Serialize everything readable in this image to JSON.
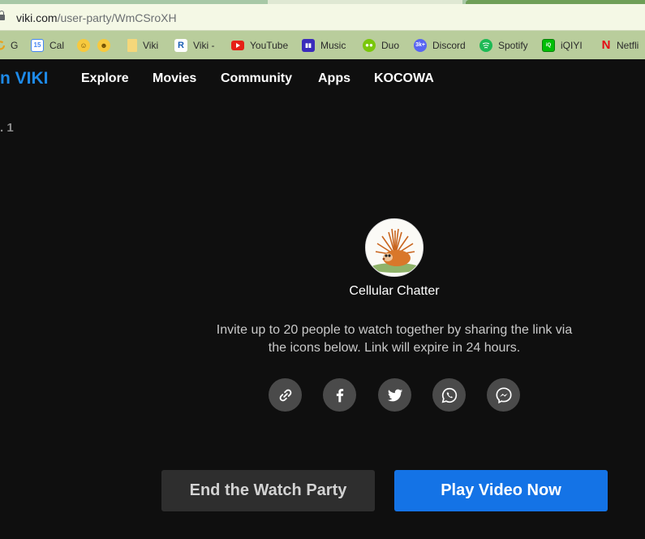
{
  "browser": {
    "url_host": "viki.com",
    "url_path": "/user-party/WmCSroXH",
    "bookmarks": [
      {
        "label": "G",
        "icon": "google-icon"
      },
      {
        "label": "Cal",
        "icon": "calendar-icon"
      },
      {
        "label": "",
        "icon": "smiley-icon"
      },
      {
        "label": "",
        "icon": "yum-emoji-icon"
      },
      {
        "label": "Viki",
        "icon": "folder-icon"
      },
      {
        "label": "Viki -",
        "icon": "r-logo-icon"
      },
      {
        "label": "YouTube",
        "icon": "youtube-icon"
      },
      {
        "label": "Music",
        "icon": "music-icon"
      },
      {
        "label": "Duo",
        "icon": "duolingo-icon"
      },
      {
        "label": "Discord",
        "icon": "discord-icon"
      },
      {
        "label": "Spotify",
        "icon": "spotify-icon"
      },
      {
        "label": "iQIYI",
        "icon": "iqiyi-icon"
      },
      {
        "label": "Netfli",
        "icon": "netflix-icon"
      }
    ]
  },
  "header": {
    "logo": "n VIKI",
    "nav": [
      "Explore",
      "Movies",
      "Community",
      "Apps",
      "KOCOWA"
    ]
  },
  "side_text": ". 1",
  "party": {
    "host_name": "Cellular Chatter",
    "invite_line1": "Invite up to 20 people to watch together by sharing the link via",
    "invite_line2": "the icons below. Link will expire in 24 hours.",
    "share_icons": [
      "link-icon",
      "facebook-icon",
      "twitter-icon",
      "whatsapp-icon",
      "messenger-icon"
    ]
  },
  "buttons": {
    "end_label": "End the Watch Party",
    "play_label": "Play Video Now"
  },
  "colors": {
    "accent": "#1473e6",
    "logo": "#1e8ae8",
    "background": "#0f0f0f"
  }
}
